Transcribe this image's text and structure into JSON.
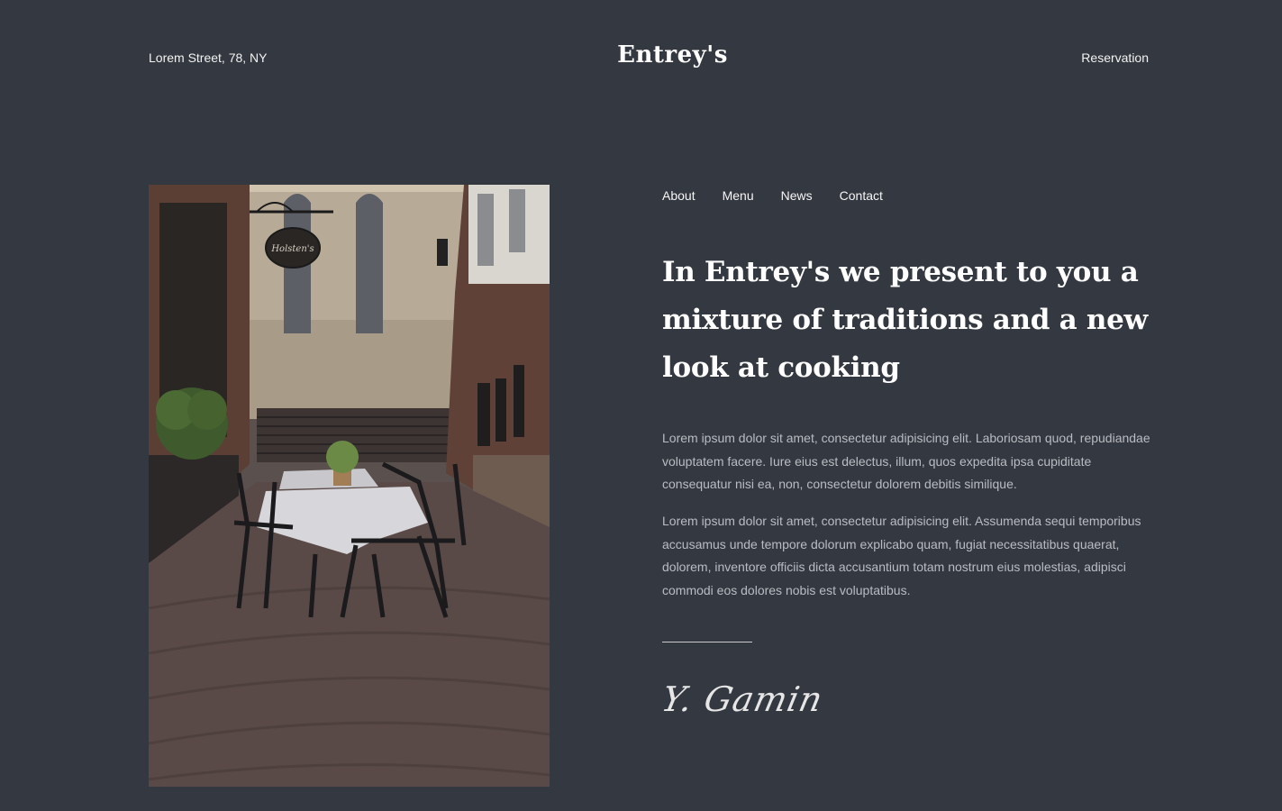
{
  "header": {
    "address": "Lorem Street, 78, NY",
    "brand": "Entrey's",
    "reservation_label": "Reservation"
  },
  "nav": {
    "items": [
      "About",
      "Menu",
      "News",
      "Contact"
    ]
  },
  "hero": {
    "headline": "In Entrey's we present to you a mixture of traditions and a new look at cooking",
    "paragraph_1": "Lorem ipsum dolor sit amet, consectetur adipisicing elit. Laboriosam quod, repudiandae voluptatem facere. Iure eius est delectus, illum, quos expedita ipsa cupiditate consequatur nisi ea, non, consectetur dolorem debitis similique.",
    "paragraph_2": "Lorem ipsum dolor sit amet, consectetur adipisicing elit. Assumenda sequi temporibus accusamus unde tempore dolorum explicabo quam, fugiat necessitatibus quaerat, dolorem, inventore officiis dicta accusantium totam nostrum eius molestias, adipisci commodi eos dolores nobis est voluptatibus.",
    "signature": "Y. Gamin",
    "photo_sign_text": "Holsten's"
  },
  "colors": {
    "background": "#343840",
    "text": "#ffffff",
    "muted_text": "#b9bcc2"
  }
}
